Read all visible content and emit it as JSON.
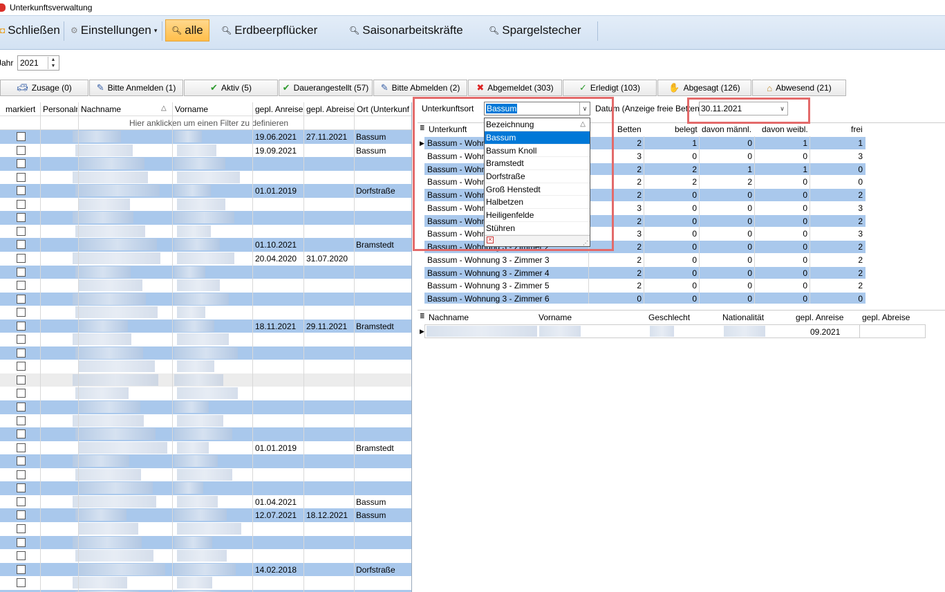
{
  "window": {
    "title": "Unterkunftsverwaltung"
  },
  "ribbon": {
    "close": "Schließen",
    "settings": "Einstellungen",
    "all": "alle",
    "strawberry": "Erdbeerpflücker",
    "seasonal": "Saisonarbeitskräfte",
    "asparagus": "Spargelstecher"
  },
  "year": {
    "label": "Jahr",
    "value": "2021"
  },
  "tabs": [
    "Zusage (0)",
    "Bitte Anmelden (1)",
    "Aktiv (5)",
    "Dauerangestellt (57)",
    "Bitte Abmelden (2)",
    "Abgemeldet (303)",
    "Erledigt (103)",
    "Abgesagt (126)",
    "Abwesend (21)"
  ],
  "left_grid": {
    "headers": [
      "markiert",
      "Personalr",
      "Nachname",
      "Vorname",
      "gepl. Anreise",
      "gepl. Abreise",
      "Ort (Unterkunf"
    ],
    "filter_hint": "Hier anklicken um einen Filter zu definieren",
    "rows": [
      {
        "arr": "19.06.2021",
        "dep": "27.11.2021",
        "ort": "Bassum"
      },
      {
        "arr": "19.09.2021",
        "dep": "",
        "ort": "Bassum"
      },
      {
        "arr": "",
        "dep": "",
        "ort": ""
      },
      {
        "arr": "",
        "dep": "",
        "ort": ""
      },
      {
        "arr": "01.01.2019",
        "dep": "",
        "ort": "Dorfstraße"
      },
      {
        "arr": "",
        "dep": "",
        "ort": ""
      },
      {
        "arr": "",
        "dep": "",
        "ort": ""
      },
      {
        "arr": "",
        "dep": "",
        "ort": ""
      },
      {
        "arr": "01.10.2021",
        "dep": "",
        "ort": "Bramstedt"
      },
      {
        "arr": "20.04.2020",
        "dep": "31.07.2020",
        "ort": ""
      },
      {
        "arr": "",
        "dep": "",
        "ort": ""
      },
      {
        "arr": "",
        "dep": "",
        "ort": ""
      },
      {
        "arr": "",
        "dep": "",
        "ort": ""
      },
      {
        "arr": "",
        "dep": "",
        "ort": ""
      },
      {
        "arr": "18.11.2021",
        "dep": "29.11.2021",
        "ort": "Bramstedt"
      },
      {
        "arr": "",
        "dep": "",
        "ort": ""
      },
      {
        "arr": "",
        "dep": "",
        "ort": ""
      },
      {
        "arr": "",
        "dep": "",
        "ort": ""
      },
      {
        "arr": "",
        "dep": "",
        "ort": ""
      },
      {
        "arr": "",
        "dep": "",
        "ort": ""
      },
      {
        "arr": "",
        "dep": "",
        "ort": ""
      },
      {
        "arr": "",
        "dep": "",
        "ort": ""
      },
      {
        "arr": "",
        "dep": "",
        "ort": ""
      },
      {
        "arr": "01.01.2019",
        "dep": "",
        "ort": "Bramstedt"
      },
      {
        "arr": "",
        "dep": "",
        "ort": ""
      },
      {
        "arr": "",
        "dep": "",
        "ort": ""
      },
      {
        "arr": "",
        "dep": "",
        "ort": ""
      },
      {
        "arr": "01.04.2021",
        "dep": "",
        "ort": "Bassum"
      },
      {
        "arr": "12.07.2021",
        "dep": "18.12.2021",
        "ort": "Bassum"
      },
      {
        "arr": "",
        "dep": "",
        "ort": ""
      },
      {
        "arr": "",
        "dep": "",
        "ort": ""
      },
      {
        "arr": "",
        "dep": "",
        "ort": ""
      },
      {
        "arr": "14.02.2018",
        "dep": "",
        "ort": "Dorfstraße"
      },
      {
        "arr": "",
        "dep": "",
        "ort": ""
      },
      {
        "arr": "",
        "dep": "",
        "ort": ""
      }
    ]
  },
  "filters": {
    "location_label": "Unterkunftsort",
    "location_value": "Bassum",
    "date_label": "Datum (Anzeige freie Betten)",
    "date_value": "30.11.2021"
  },
  "dropdown": {
    "header": "Bezeichnung",
    "items": [
      "Bassum",
      "Bassum Knoll",
      "Bramstedt",
      "Dorfstraße",
      "Groß Henstedt",
      "Halbetzen",
      "Heiligenfelde",
      "Stühren"
    ]
  },
  "room_grid": {
    "headers": [
      "Unterkunft",
      "Betten",
      "belegt",
      "davon männl.",
      "davon weibl.",
      "frei"
    ],
    "rows": [
      {
        "name": "Bassum - Wohnung 1 -  Zimmer 1",
        "b": "2",
        "o": "1",
        "m": "0",
        "w": "1",
        "f": "1"
      },
      {
        "name": "Bassum - Wohnung 1 -  Zimmer 2",
        "b": "3",
        "o": "0",
        "m": "0",
        "w": "0",
        "f": "3"
      },
      {
        "name": "Bassum - Wohnung 1 -  Zimmer 3",
        "b": "2",
        "o": "2",
        "m": "1",
        "w": "1",
        "f": "0"
      },
      {
        "name": "Bassum - Wohnung 2 -  Zimmer 1",
        "b": "2",
        "o": "2",
        "m": "2",
        "w": "0",
        "f": "0"
      },
      {
        "name": "Bassum - Wohnung 2 -  Zimmer 2",
        "b": "2",
        "o": "0",
        "m": "0",
        "w": "0",
        "f": "2"
      },
      {
        "name": "Bassum - Wohnung 2 -  Zimmer 3",
        "b": "3",
        "o": "0",
        "m": "0",
        "w": "0",
        "f": "3"
      },
      {
        "name": "Bassum - Wohnung 2 -  Zimmer 4",
        "b": "2",
        "o": "0",
        "m": "0",
        "w": "0",
        "f": "2"
      },
      {
        "name": "Bassum -  Wohnung 3 -  Zimmer 1",
        "b": "3",
        "o": "0",
        "m": "0",
        "w": "0",
        "f": "3"
      },
      {
        "name": "Bassum -  Wohnung 3 -  Zimmer 2",
        "b": "2",
        "o": "0",
        "m": "0",
        "w": "0",
        "f": "2"
      },
      {
        "name": "Bassum - Wohnung 3 -  Zimmer 3",
        "b": "2",
        "o": "0",
        "m": "0",
        "w": "0",
        "f": "2"
      },
      {
        "name": "Bassum - Wohnung 3 -  Zimmer 4",
        "b": "2",
        "o": "0",
        "m": "0",
        "w": "0",
        "f": "2"
      },
      {
        "name": "Bassum - Wohnung 3 -  Zimmer 5",
        "b": "2",
        "o": "0",
        "m": "0",
        "w": "0",
        "f": "2"
      },
      {
        "name": "Bassum -  Wohnung 3 - Zimmer 6",
        "b": "0",
        "o": "0",
        "m": "0",
        "w": "0",
        "f": "0"
      }
    ]
  },
  "occupant_grid": {
    "headers": [
      "Nachname",
      "Vorname",
      "Geschlecht",
      "Nationalität",
      "gepl. Anreise",
      "gepl. Abreise"
    ],
    "row_arrival": "09.2021"
  }
}
